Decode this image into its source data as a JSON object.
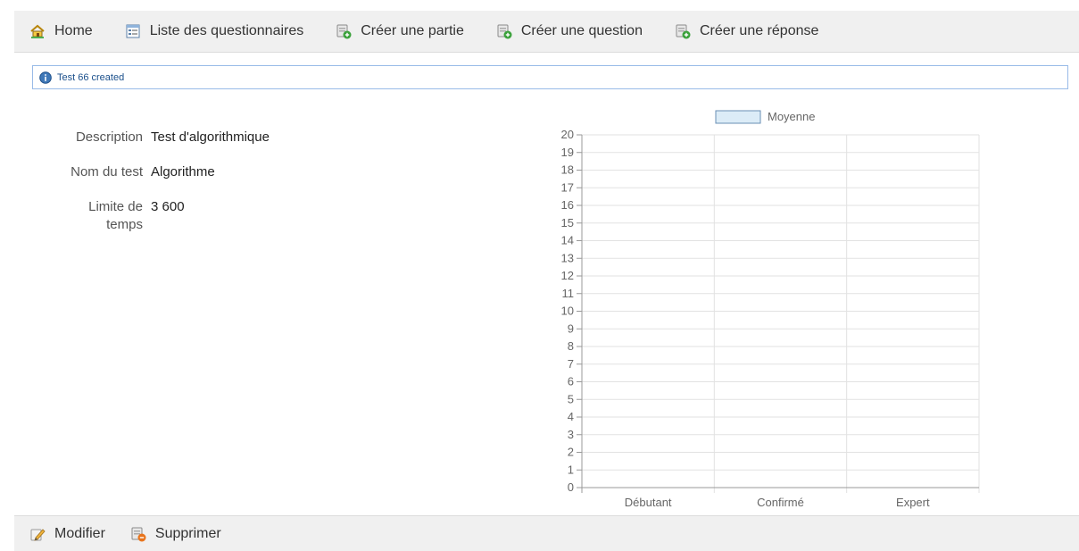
{
  "nav": {
    "items": [
      {
        "label": "Home",
        "icon": "home-icon"
      },
      {
        "label": "Liste des questionnaires",
        "icon": "list-icon"
      },
      {
        "label": "Créer une partie",
        "icon": "add-document-icon"
      },
      {
        "label": "Créer une question",
        "icon": "add-document-icon"
      },
      {
        "label": "Créer une réponse",
        "icon": "add-document-icon"
      }
    ]
  },
  "flash": {
    "message": "Test 66 created",
    "icon": "info-icon"
  },
  "details": {
    "description_label": "Description",
    "description_value": "Test d'algorithmique",
    "name_label": "Nom du test",
    "name_value": "Algorithme",
    "time_label": "Limite de temps",
    "time_value": "3 600"
  },
  "chart_data": {
    "type": "bar",
    "categories": [
      "Débutant",
      "Confirmé",
      "Expert"
    ],
    "series": [
      {
        "name": "Moyenne",
        "values": [
          0,
          0,
          0
        ]
      }
    ],
    "ylim": [
      0,
      20
    ],
    "yticks": [
      0,
      1,
      2,
      3,
      4,
      5,
      6,
      7,
      8,
      9,
      10,
      11,
      12,
      13,
      14,
      15,
      16,
      17,
      18,
      19,
      20
    ],
    "legend": "top-center",
    "grid": true,
    "series_fill": "#dcecf7",
    "series_stroke": "#6a8fb5"
  },
  "footer": {
    "items": [
      {
        "label": "Modifier",
        "icon": "pencil-icon"
      },
      {
        "label": "Supprimer",
        "icon": "delete-document-icon"
      }
    ]
  },
  "colors": {
    "flash_border": "#99bbe8",
    "toolbar_bg": "#f0f0f0",
    "flash_text": "#1a4f8b"
  }
}
